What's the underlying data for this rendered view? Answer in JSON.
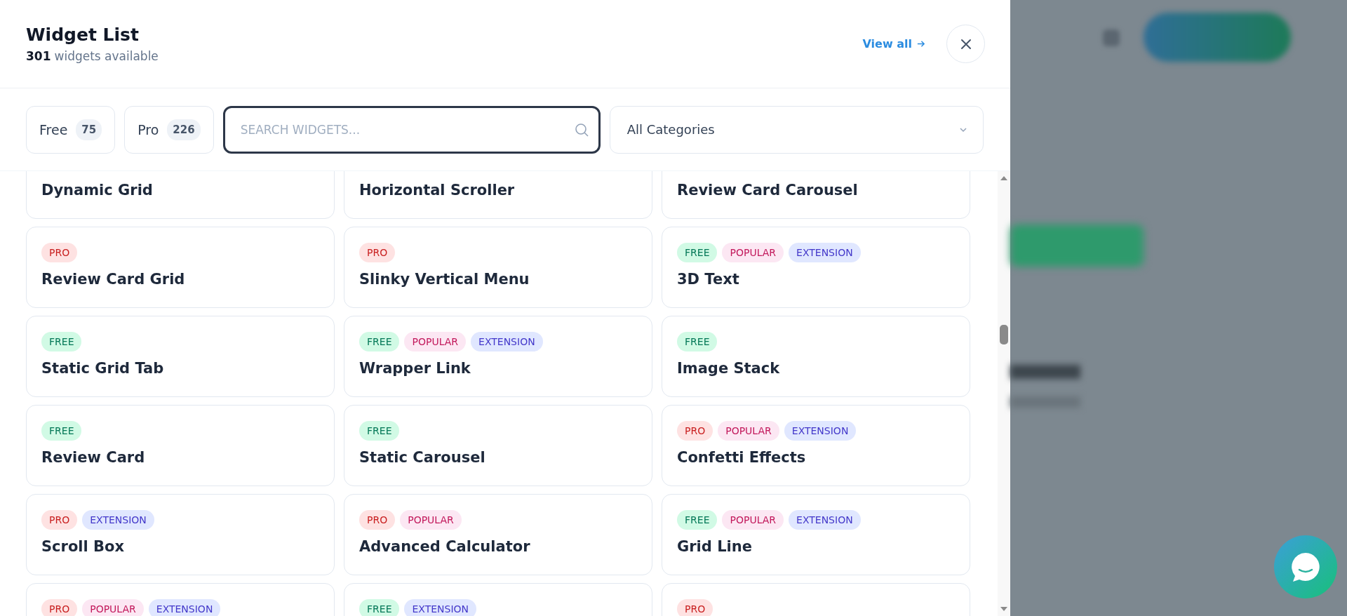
{
  "panel": {
    "title": "Widget List",
    "count": "301",
    "subtitle": "widgets available",
    "view_all": "View all"
  },
  "filters": [
    {
      "label": "Free",
      "count": "75"
    },
    {
      "label": "Pro",
      "count": "226"
    }
  ],
  "search": {
    "placeholder": "SEARCH WIDGETS..."
  },
  "category": {
    "value": "All Categories"
  },
  "widgets": [
    {
      "title": "Dynamic Grid"
    },
    {
      "title": "Horizontal Scroller"
    },
    {
      "title": "Review Card Carousel"
    },
    {
      "title": "Review Card Grid",
      "tags": [
        {
          "kind": "pro",
          "label": "PRO"
        }
      ]
    },
    {
      "title": "Slinky Vertical Menu",
      "tags": [
        {
          "kind": "pro",
          "label": "PRO"
        }
      ]
    },
    {
      "title": "3D Text",
      "tags": [
        {
          "kind": "free",
          "label": "FREE"
        },
        {
          "kind": "popular",
          "label": "POPULAR"
        },
        {
          "kind": "extension",
          "label": "EXTENSION"
        }
      ]
    },
    {
      "title": "Static Grid Tab",
      "tags": [
        {
          "kind": "free",
          "label": "FREE"
        }
      ]
    },
    {
      "title": "Wrapper Link",
      "tags": [
        {
          "kind": "free",
          "label": "FREE"
        },
        {
          "kind": "popular",
          "label": "POPULAR"
        },
        {
          "kind": "extension",
          "label": "EXTENSION"
        }
      ]
    },
    {
      "title": "Image Stack",
      "tags": [
        {
          "kind": "free",
          "label": "FREE"
        }
      ]
    },
    {
      "title": "Review Card",
      "tags": [
        {
          "kind": "free",
          "label": "FREE"
        }
      ]
    },
    {
      "title": "Static Carousel",
      "tags": [
        {
          "kind": "free",
          "label": "FREE"
        }
      ]
    },
    {
      "title": "Confetti Effects",
      "tags": [
        {
          "kind": "pro",
          "label": "PRO"
        },
        {
          "kind": "popular",
          "label": "POPULAR"
        },
        {
          "kind": "extension",
          "label": "EXTENSION"
        }
      ]
    },
    {
      "title": "Scroll Box",
      "tags": [
        {
          "kind": "pro",
          "label": "PRO"
        },
        {
          "kind": "extension",
          "label": "EXTENSION"
        }
      ]
    },
    {
      "title": "Advanced Calculator",
      "tags": [
        {
          "kind": "pro",
          "label": "PRO"
        },
        {
          "kind": "popular",
          "label": "POPULAR"
        }
      ]
    },
    {
      "title": "Grid Line",
      "tags": [
        {
          "kind": "free",
          "label": "FREE"
        },
        {
          "kind": "popular",
          "label": "POPULAR"
        },
        {
          "kind": "extension",
          "label": "EXTENSION"
        }
      ]
    },
    {
      "tags": [
        {
          "kind": "pro",
          "label": "PRO"
        },
        {
          "kind": "popular",
          "label": "POPULAR"
        },
        {
          "kind": "extension",
          "label": "EXTENSION"
        }
      ]
    },
    {
      "tags": [
        {
          "kind": "free",
          "label": "FREE"
        },
        {
          "kind": "extension",
          "label": "EXTENSION"
        }
      ]
    },
    {
      "tags": [
        {
          "kind": "pro",
          "label": "PRO"
        }
      ]
    }
  ]
}
